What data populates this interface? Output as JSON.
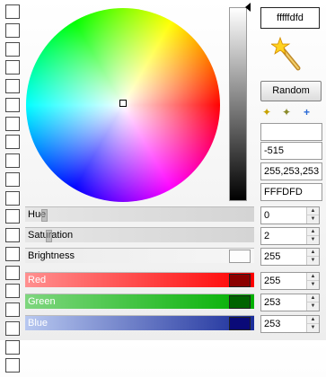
{
  "swatch_count": 20,
  "hex_display": "fffffdfd",
  "random_button": "Random",
  "icons": [
    "star-up-icon",
    "star-down-icon",
    "plus-icon"
  ],
  "info": {
    "blank": "",
    "int_value": "-515",
    "rgb_value": "255,253,253",
    "hex_value": "FFFDFD"
  },
  "sliders": [
    {
      "label": "Hue",
      "value": "0",
      "level": 0.0
    },
    {
      "label": "Saturation",
      "value": "2",
      "level": 0.02
    },
    {
      "label": "Brightness",
      "value": "255",
      "level": 1.0
    },
    {
      "label": "Red",
      "value": "255",
      "level": 1.0
    },
    {
      "label": "Green",
      "value": "253",
      "level": 0.99
    },
    {
      "label": "Blue",
      "value": "253",
      "level": 0.99
    }
  ],
  "colors": {
    "current": "#FFFDFD",
    "red": "#8B0000",
    "green": "#006400",
    "blue": "#0A0A78"
  }
}
